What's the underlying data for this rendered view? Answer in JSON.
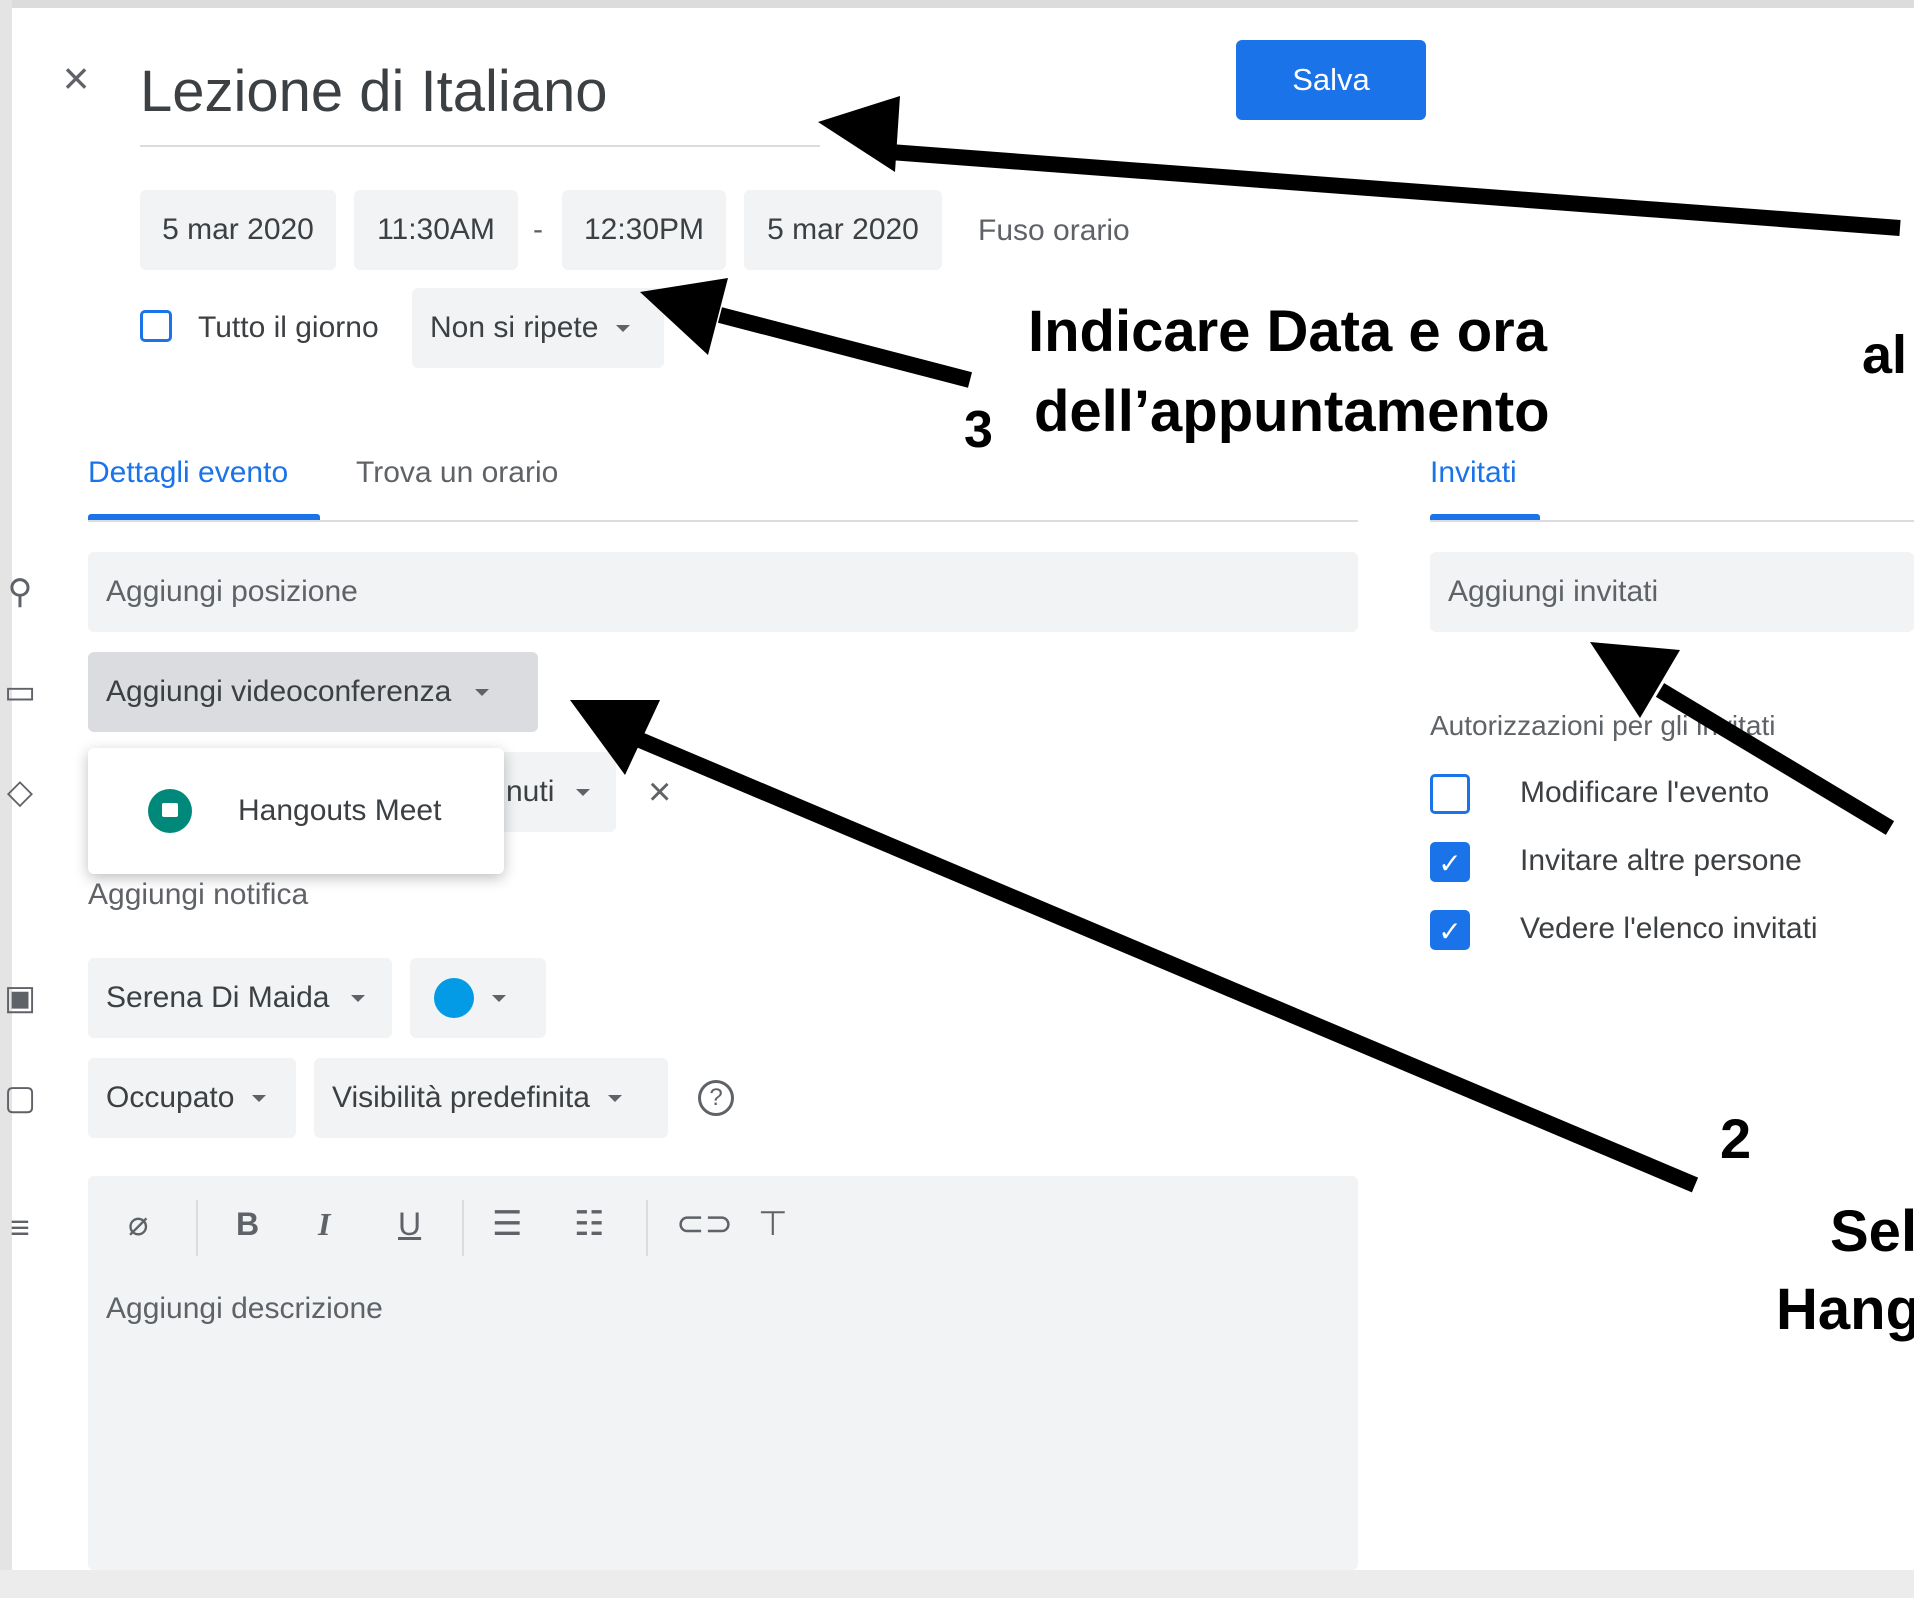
{
  "header": {
    "close_glyph": "×",
    "title": "Lezione di Italiano",
    "save_label": "Salva"
  },
  "datetime": {
    "start_date": "5 mar 2020",
    "start_time": "11:30AM",
    "separator": "-",
    "end_time": "12:30PM",
    "end_date": "5 mar 2020",
    "timezone_label": "Fuso orario",
    "all_day_label": "Tutto il giorno",
    "repeat_label": "Non si ripete"
  },
  "tabs": {
    "details": "Dettagli evento",
    "find_time": "Trova un orario",
    "guests": "Invitati"
  },
  "details": {
    "location_placeholder": "Aggiungi posizione",
    "videoconf_label": "Aggiungi videoconferenza",
    "notification_partial": "nuti",
    "add_notification": "Aggiungi notifica",
    "calendar_owner": "Serena Di Maida",
    "calendar_color": "#039be5",
    "status_label": "Occupato",
    "visibility_label": "Visibilità predefinita",
    "help_glyph": "?",
    "description_placeholder": "Aggiungi descrizione"
  },
  "menu": {
    "item_label": "Hangouts Meet",
    "item_icon": "meet-icon"
  },
  "guests": {
    "add_placeholder": "Aggiungi invitati",
    "permissions_title": "Autorizzazioni per gli invitati",
    "permissions": [
      {
        "label": "Modificare l'evento",
        "checked": false
      },
      {
        "label": "Invitare altre persone",
        "checked": true
      },
      {
        "label": "Vedere l'elenco invitati",
        "checked": true
      }
    ]
  },
  "toolbar": {
    "attach": "attach-icon",
    "bold": "B",
    "italic": "I",
    "underline": "U",
    "numbered": "numbered-list-icon",
    "bulleted": "bulleted-list-icon",
    "link": "link-icon",
    "clear": "clear-format-icon"
  },
  "annotations": {
    "date_line1": "Indicare Data e ora",
    "date_line2": "dell’appuntamento",
    "step3": "3",
    "step2": "2",
    "right_partial_al": "al",
    "right_partial_sel": "Sel",
    "right_partial_hang": "Hang"
  },
  "colors": {
    "accent": "#1a73e8",
    "chip_bg": "#f1f3f4",
    "text": "#3c4043",
    "muted": "#5f6368"
  }
}
